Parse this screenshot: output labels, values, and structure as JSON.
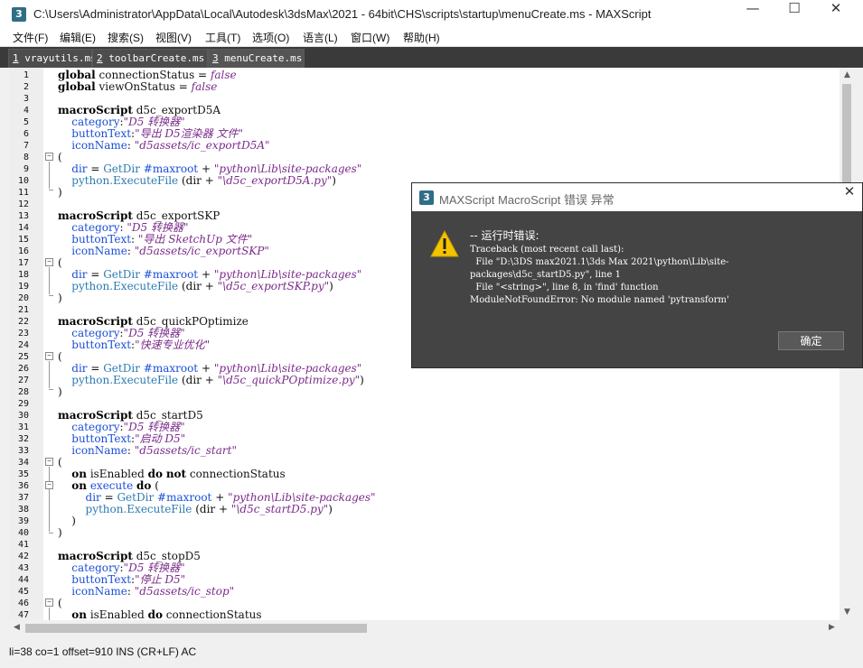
{
  "window": {
    "title": "C:\\Users\\Administrator\\AppData\\Local\\Autodesk\\3dsMax\\2021 - 64bit\\CHS\\scripts\\startup\\menuCreate.ms - MAXScript",
    "app_icon_label": "3",
    "icon": "maxscript-app-icon"
  },
  "menu": [
    "文件(F)",
    "编辑(E)",
    "搜索(S)",
    "视图(V)",
    "工具(T)",
    "选项(O)",
    "语言(L)",
    "窗口(W)",
    "帮助(H)"
  ],
  "tabs": [
    {
      "num": "1",
      "name": " vrayutils.ms"
    },
    {
      "num": "2",
      "name": " toolbarCreate.ms"
    },
    {
      "num": "3",
      "name": " menuCreate.ms"
    }
  ],
  "editor": {
    "line_numbers": [
      "1",
      "2",
      "3",
      "4",
      "5",
      "6",
      "7",
      "8",
      "9",
      "10",
      "11",
      "12",
      "13",
      "14",
      "15",
      "16",
      "17",
      "18",
      "19",
      "20",
      "21",
      "22",
      "23",
      "24",
      "25",
      "26",
      "27",
      "28",
      "29",
      "30",
      "31",
      "32",
      "33",
      "34",
      "35",
      "36",
      "37",
      "38",
      "39",
      "40",
      "41",
      "42",
      "43",
      "44",
      "45",
      "46",
      "47"
    ]
  },
  "status": {
    "text": "li=38 co=1 offset=910 INS (CR+LF) AC"
  },
  "dialog": {
    "title": "MAXScript MacroScript 错误 异常",
    "icon": "warning-icon",
    "heading": "-- 运行时错误:",
    "lines": [
      "Traceback (most recent call last):",
      "  File \"D:\\3DS max2021.1\\3ds Max 2021\\python\\Lib\\site-",
      "packages\\d5c_startD5.py\", line 1",
      "  File \"<string>\", line 8, in 'find' function",
      "ModuleNotFoundError: No module named 'pytransform'"
    ],
    "ok_label": "确定"
  }
}
